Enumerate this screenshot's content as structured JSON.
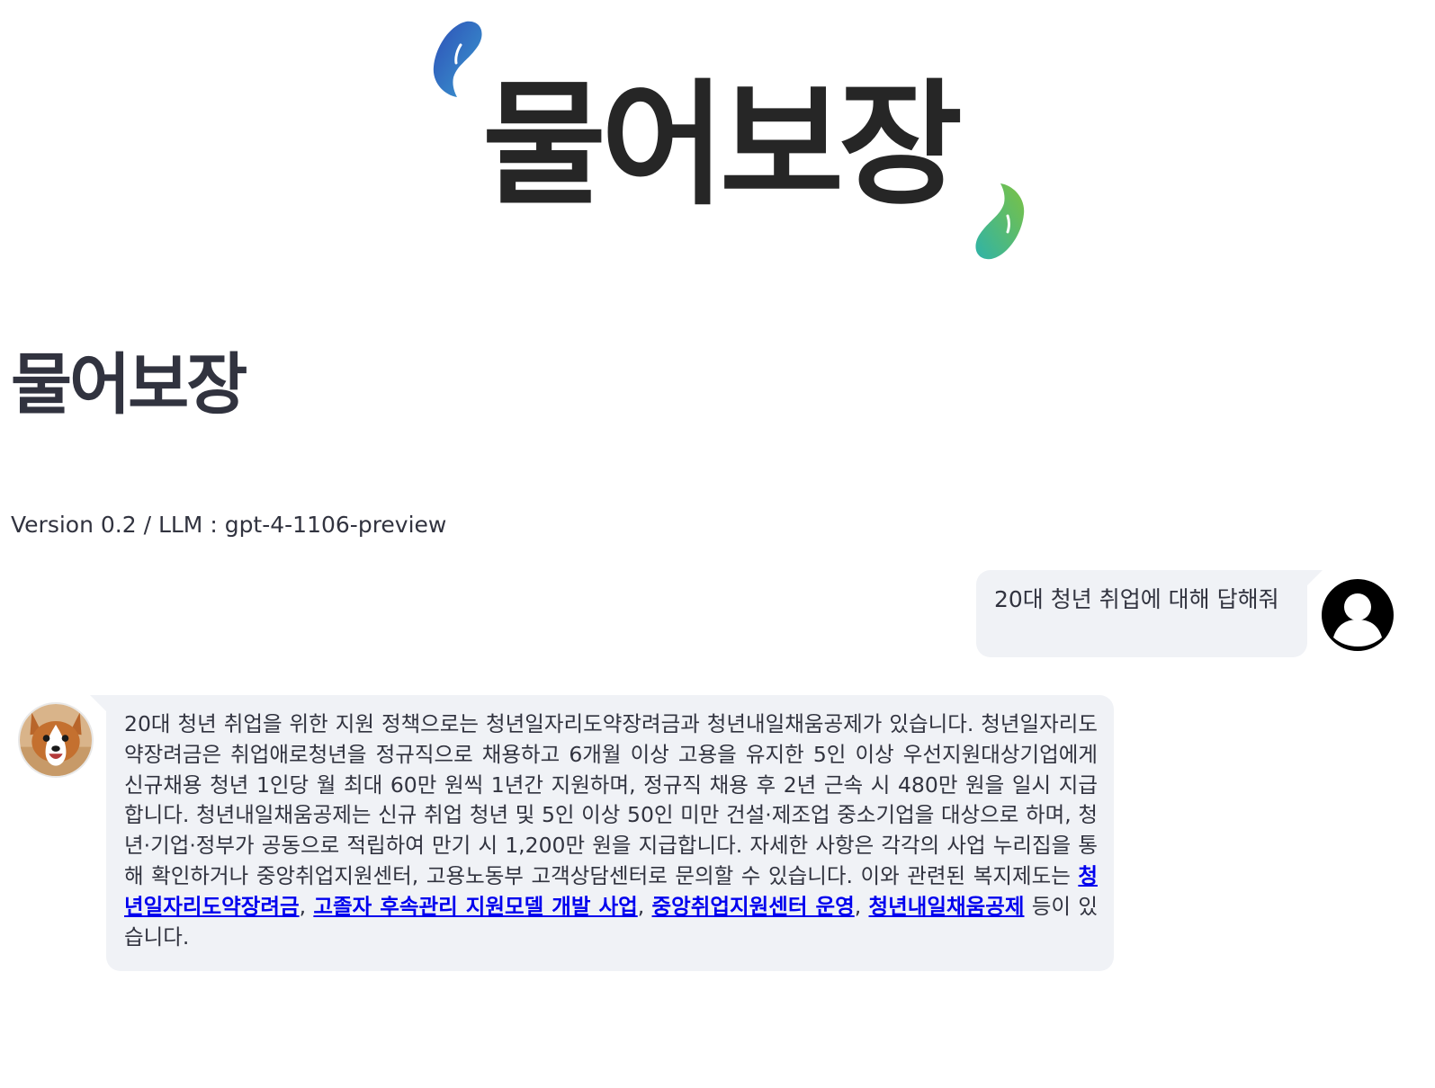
{
  "logo": {
    "text": "물어보장",
    "colors": {
      "word": "#262626",
      "drop_left_start": "#2e4fb7",
      "drop_left_end": "#3a9bd0",
      "drop_right_start": "#2fb3a8",
      "drop_right_end": "#7cc242"
    }
  },
  "header": {
    "title": "물어보장",
    "version": "Version 0.2 / LLM : gpt-4-1106-preview"
  },
  "chat": {
    "user_message": {
      "text": "20대 청년 취업에 대해 답해줘",
      "avatar_icon": "user-silhouette-icon"
    },
    "assistant_message": {
      "avatar_icon": "corgi-dog-avatar",
      "text": "20대 청년 취업을 위한 지원 정책으로는 청년일자리도약장려금과 청년내일채움공제가 있습니다. 청년일자리도약장려금은 취업애로청년을 정규직으로 채용하고 6개월 이상 고용을 유지한 5인 이상 우선지원대상기업에게 신규채용 청년 1인당 월 최대 60만 원씩 1년간 지원하며, 정규직 채용 후 2년 근속 시 480만 원을 일시 지급합니다. 청년내일채움공제는 신규 취업 청년 및 5인 이상 50인 미만 건설·제조업 중소기업을 대상으로 하며, 청년·기업·정부가 공동으로 적립하여 만기 시 1,200만 원을 지급합니다. 자세한 사항은 각각의 사업 누리집을 통해 확인하거나 중앙취업지원센터, 고용노동부 고객상담센터로 문의할 수 있습니다. 이와 관련된 복지제도는 ",
      "links": [
        {
          "label": "청년일자리도약장려금",
          "sep": ", "
        },
        {
          "label": "고졸자 후속관리 지원모델 개발 사업",
          "sep": ", "
        },
        {
          "label": "중앙취업지원센터 운영",
          "sep": ", "
        },
        {
          "label": "청년내일채움공제",
          "sep": " "
        }
      ],
      "suffix": "등이 있습니다."
    }
  },
  "colors": {
    "bubble_bg": "#f0f2f6",
    "link": "#0000ee",
    "text": "#31333f"
  }
}
